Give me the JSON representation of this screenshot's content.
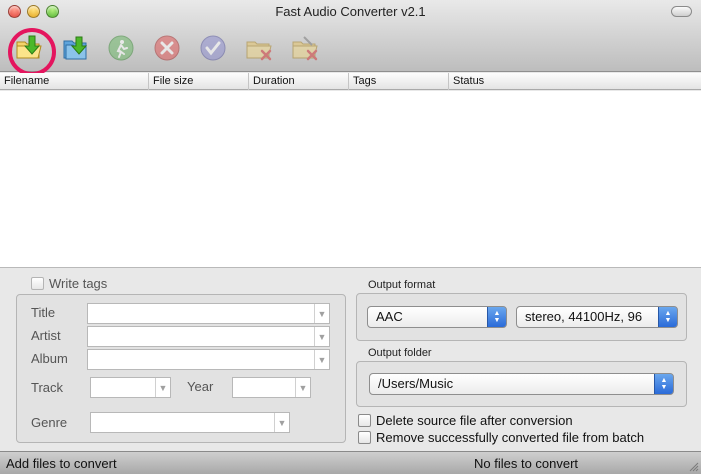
{
  "window": {
    "title": "Fast Audio Converter v2.1"
  },
  "toolbar": {
    "buttons": [
      {
        "icon": "add-files-icon"
      },
      {
        "icon": "add-folder-icon"
      },
      {
        "icon": "convert-icon"
      },
      {
        "icon": "stop-icon"
      },
      {
        "icon": "done-icon"
      },
      {
        "icon": "remove-folder-icon"
      },
      {
        "icon": "clear-list-icon"
      }
    ]
  },
  "table": {
    "columns": [
      "Filename",
      "File size",
      "Duration",
      "Tags",
      "Status"
    ],
    "rows": []
  },
  "tags": {
    "write_tags_label": "Write tags",
    "title_label": "Title",
    "artist_label": "Artist",
    "album_label": "Album",
    "track_label": "Track",
    "year_label": "Year",
    "genre_label": "Genre"
  },
  "output": {
    "format_label": "Output format",
    "format_value": "AAC",
    "quality_value": "stereo, 44100Hz, 96",
    "folder_label": "Output folder",
    "folder_value": "/Users/Music",
    "delete_source_label": "Delete source file after conversion",
    "remove_converted_label": "Remove successfully converted file from batch"
  },
  "status": {
    "left": "Add files to convert",
    "right": "No files to convert"
  },
  "colors": {
    "highlight_ring": "#e4155e",
    "popup_accent": "#2a6ad8"
  }
}
